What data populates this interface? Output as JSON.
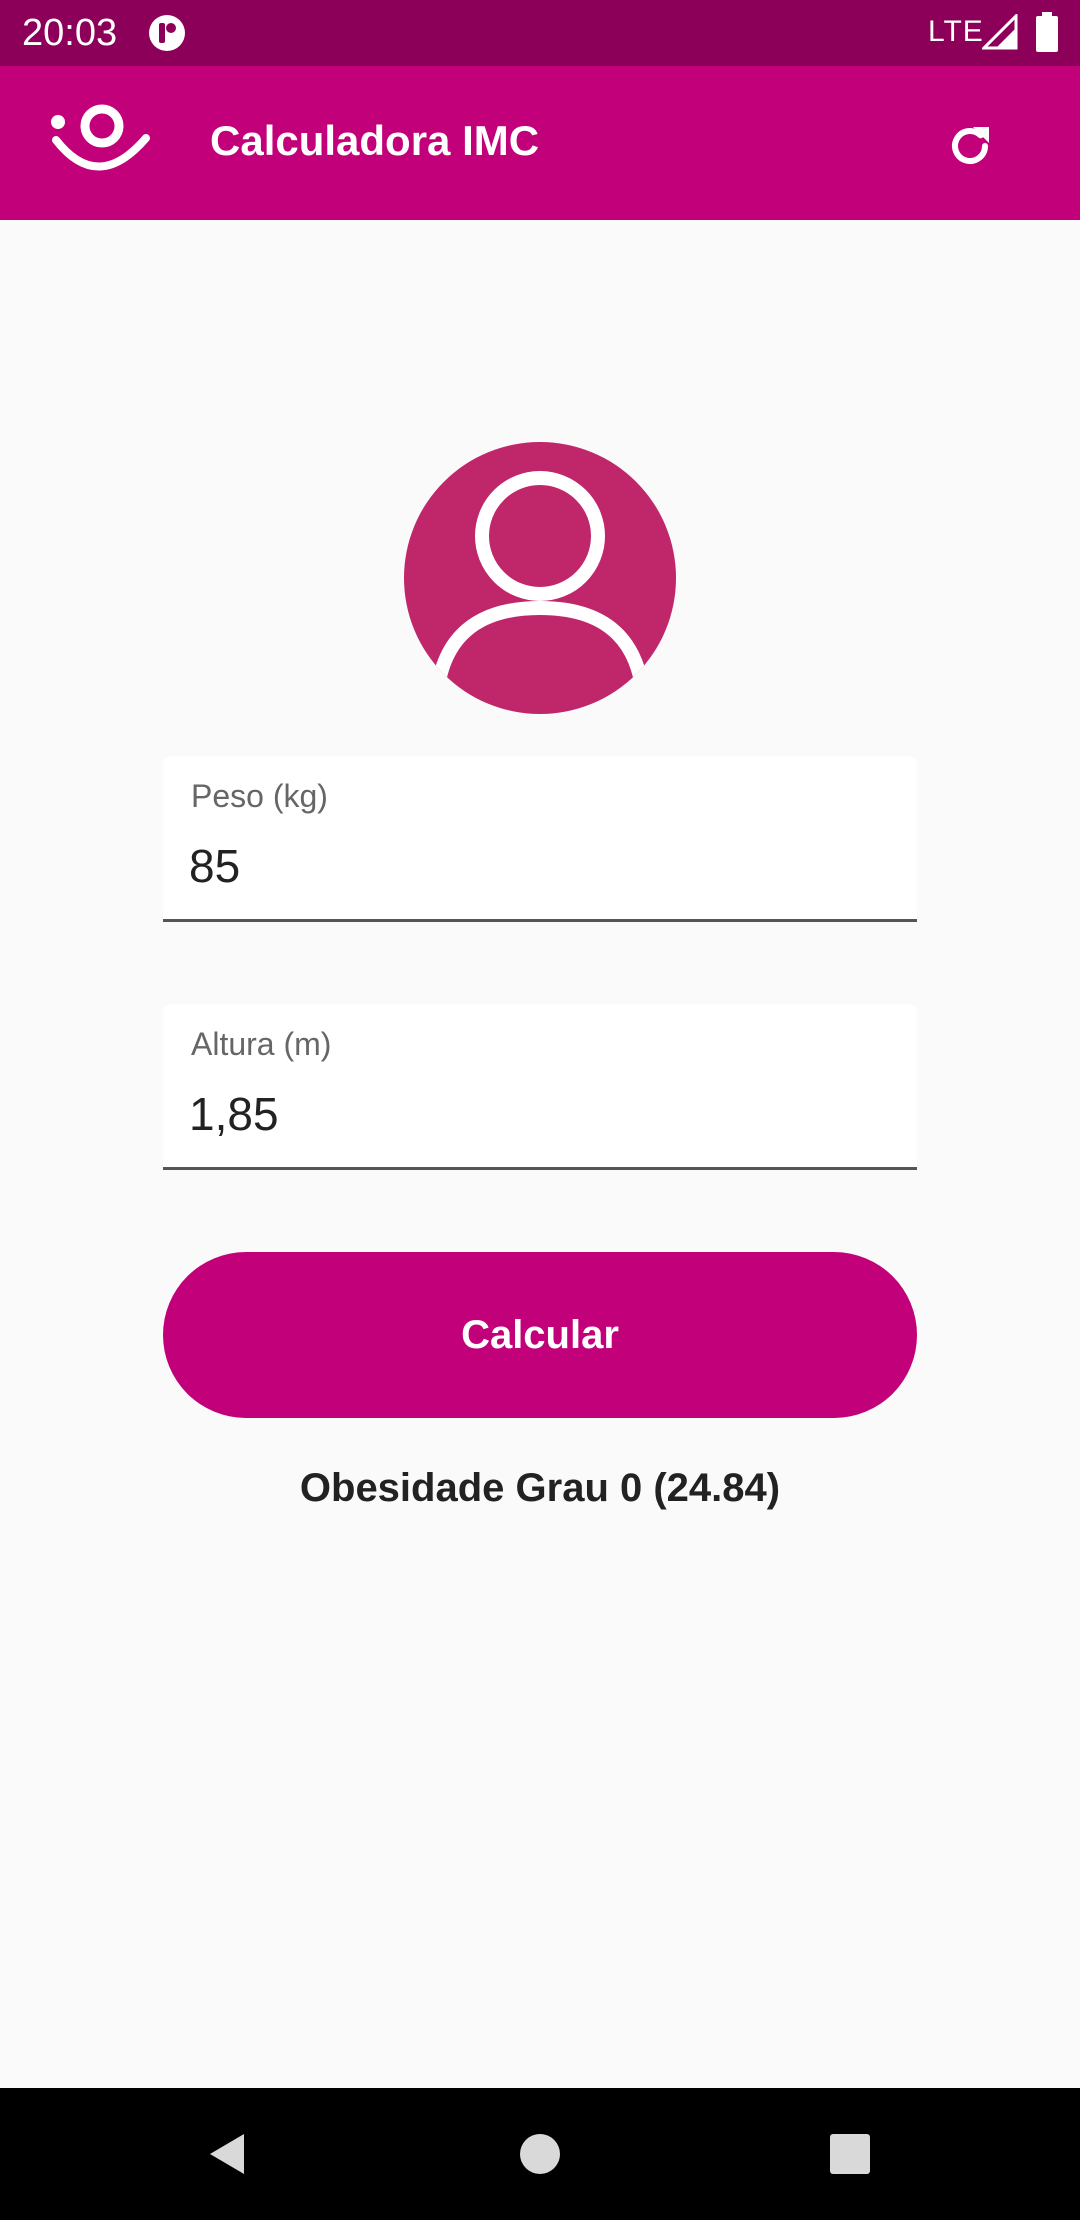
{
  "status_bar": {
    "time": "20:03",
    "network": "LTE"
  },
  "app_bar": {
    "title": "Calculadora IMC",
    "refresh_icon": "refresh-icon"
  },
  "form": {
    "weight": {
      "label": "Peso (kg)",
      "value": "85"
    },
    "height": {
      "label": "Altura (m)",
      "value": "1,85"
    }
  },
  "calculate_button": {
    "label": "Calcular"
  },
  "result": {
    "text": "Obesidade Grau 0 (24.84)"
  },
  "colors": {
    "status_bar": "#8c005a",
    "primary": "#c2007a",
    "avatar": "#c0266a",
    "background": "#fafafa"
  },
  "icons": [
    "app-logo-icon",
    "refresh-icon",
    "person-avatar-icon",
    "back-icon",
    "home-icon",
    "recents-icon"
  ]
}
